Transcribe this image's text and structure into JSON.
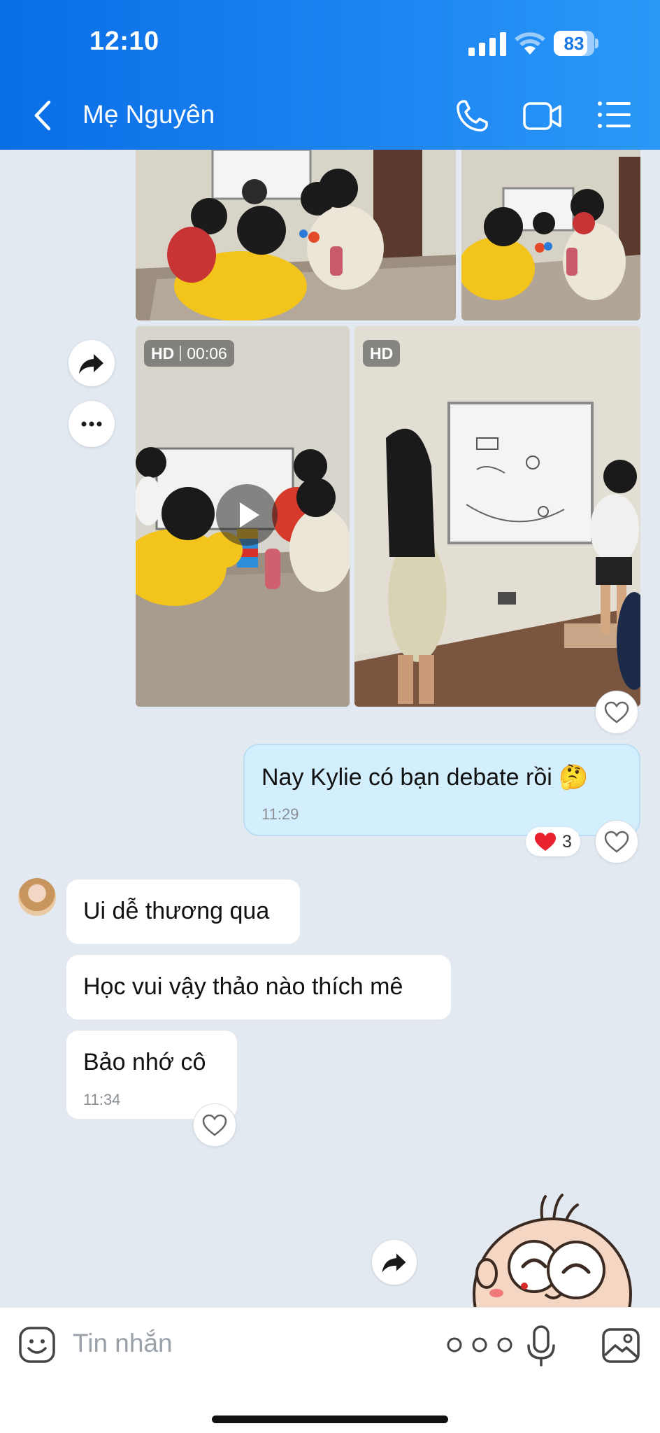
{
  "status_bar": {
    "time": "12:10",
    "battery": "83",
    "battery_level": 0.83
  },
  "header": {
    "contact_name": "Mẹ Nguyên"
  },
  "media": {
    "video1": {
      "hd": "HD",
      "duration": "00:06"
    },
    "video2": {
      "hd": "HD"
    }
  },
  "messages": {
    "outgoing": {
      "text": "Nay Kylie có bạn debate rồi 🤔",
      "time": "11:29",
      "reaction_count": "3"
    },
    "incoming": [
      {
        "text": "Ui dễ thương qua"
      },
      {
        "text": "Học vui vậy thảo nào thích mê"
      },
      {
        "text": "Bảo nhớ cô",
        "time": "11:34"
      }
    ]
  },
  "composer": {
    "placeholder": "Tin nhắn"
  },
  "colors": {
    "header_blue": "#1778e8",
    "outgoing_bubble": "#d3eefc",
    "chat_bg": "#e2e9f1",
    "reaction_red": "#e8232f"
  },
  "icons": [
    "back-icon",
    "phone-icon",
    "video-call-icon",
    "menu-icon",
    "share-icon",
    "more-icon",
    "play-icon",
    "heart-icon",
    "emoji-icon",
    "more-options-icon",
    "mic-icon",
    "image-icon"
  ]
}
